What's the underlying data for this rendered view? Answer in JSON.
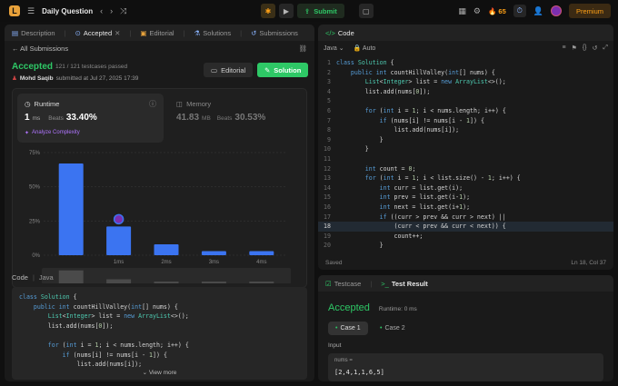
{
  "topbar": {
    "logo": "L",
    "problem_list": "Daily Question",
    "submit_label": "Submit",
    "streak": "65",
    "premium_label": "Premium"
  },
  "left_tabs": [
    {
      "label": "Description",
      "icon": "description-icon"
    },
    {
      "label": "Accepted",
      "icon": "accepted-icon"
    },
    {
      "label": "Editorial",
      "icon": "editorial-icon"
    },
    {
      "label": "Solutions",
      "icon": "solutions-icon"
    },
    {
      "label": "Submissions",
      "icon": "submissions-icon"
    }
  ],
  "back_label": "All Submissions",
  "result": {
    "status": "Accepted",
    "passed": "121 / 121 testcases passed",
    "user": "Mohd Saqib",
    "submitted": "submitted at Jul 27, 2025 17:39",
    "editorial_btn": "Editorial",
    "solution_btn": "Solution"
  },
  "runtime": {
    "label": "Runtime",
    "value": "1",
    "unit": "ms",
    "beats_label": "Beats",
    "beats": "33.40%",
    "analyze": "Analyze Complexity"
  },
  "memory": {
    "label": "Memory",
    "value": "41.83",
    "unit": "MB",
    "beats_label": "Beats",
    "beats": "30.53%"
  },
  "chart_data": {
    "type": "bar",
    "ylim": [
      0,
      75
    ],
    "yticks": [
      "75%",
      "50%",
      "25%",
      "0%"
    ],
    "x_labels": [
      "1ms",
      "2ms",
      "3ms",
      "4ms"
    ],
    "values": [
      67,
      21,
      8,
      3,
      3
    ],
    "highlight_index": 1,
    "colors": {
      "bar": "#3b74f1"
    }
  },
  "code_header": {
    "label": "Code",
    "lang": "Java"
  },
  "left_code": [
    "class Solution {",
    "    public int countHillValley(int[] nums) {",
    "        List<Integer> list = new ArrayList<>();",
    "        list.add(nums[0]);",
    "",
    "        for (int i = 1; i < nums.length; i++) {",
    "            if (nums[i] != nums[i - 1]) {",
    "                list.add(nums[i]);"
  ],
  "view_more": "View more",
  "editor": {
    "title": "Code",
    "lang": "Java",
    "auto": "Auto",
    "saved": "Saved",
    "cursor": "Ln 18, Col 37",
    "current_line": 18,
    "lines": [
      "class Solution {",
      "    public int countHillValley(int[] nums) {",
      "        List<Integer> list = new ArrayList<>();",
      "        list.add(nums[0]);",
      "",
      "        for (int i = 1; i < nums.length; i++) {",
      "            if (nums[i] != nums[i - 1]) {",
      "                list.add(nums[i]);",
      "            }",
      "        }",
      "",
      "        int count = 0;",
      "        for (int i = 1; i < list.size() - 1; i++) {",
      "            int curr = list.get(i);",
      "            int prev = list.get(i-1);",
      "            int next = list.get(i+1);",
      "            if ((curr > prev && curr > next) ||",
      "                (curr < prev && curr < next)) {",
      "                count++;",
      "            }",
      "        }"
    ]
  },
  "bottom": {
    "tab_testcase": "Testcase",
    "tab_result": "Test Result",
    "status": "Accepted",
    "runtime": "Runtime: 0 ms",
    "case1": "Case 1",
    "case2": "Case 2",
    "input_label": "Input",
    "var_name": "nums =",
    "var_value": "[2,4,1,1,6,5]"
  }
}
